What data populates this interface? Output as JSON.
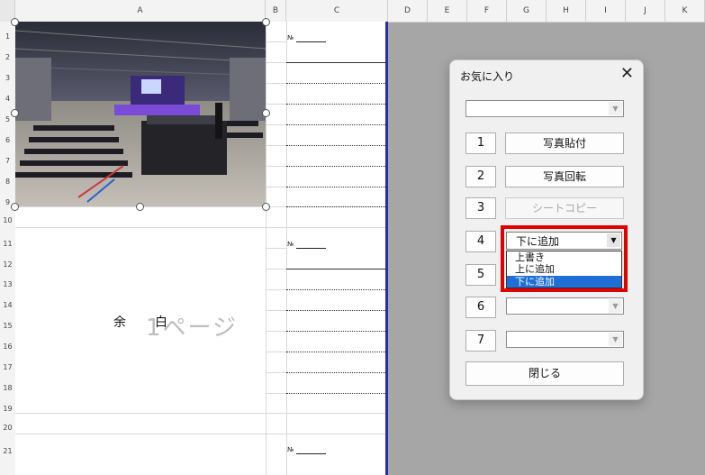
{
  "spreadsheet": {
    "columns": [
      "A",
      "B",
      "C",
      "D",
      "E",
      "F",
      "G",
      "H",
      "I",
      "J",
      "K"
    ],
    "rows": [
      "1",
      "2",
      "3",
      "4",
      "5",
      "6",
      "7",
      "8",
      "9",
      "10",
      "11",
      "12",
      "13",
      "14",
      "15",
      "16",
      "17",
      "18",
      "19",
      "20",
      "21"
    ],
    "no_label": "№",
    "blank_text_1": "余",
    "blank_text_2": "白",
    "page_label": "1ページ"
  },
  "dialog": {
    "title": "お気に入り",
    "close_glyph": "✕",
    "top_combo_value": "",
    "buttons": [
      {
        "num": "1",
        "label": "写真貼付"
      },
      {
        "num": "2",
        "label": "写真回転"
      },
      {
        "num": "3",
        "label": "シートコピー"
      },
      {
        "num": "4",
        "combo_value": "下に追加"
      },
      {
        "num": "5"
      },
      {
        "num": "6",
        "combo_value": ""
      },
      {
        "num": "7",
        "combo_value": ""
      }
    ],
    "dropdown_options": [
      "上書き",
      "上に追加",
      "下に追加"
    ],
    "close_button": "閉じる"
  },
  "colors": {
    "accent_border": "#1f2fb0",
    "highlight_red": "#e00000",
    "selection_blue": "#1f6fd6"
  }
}
